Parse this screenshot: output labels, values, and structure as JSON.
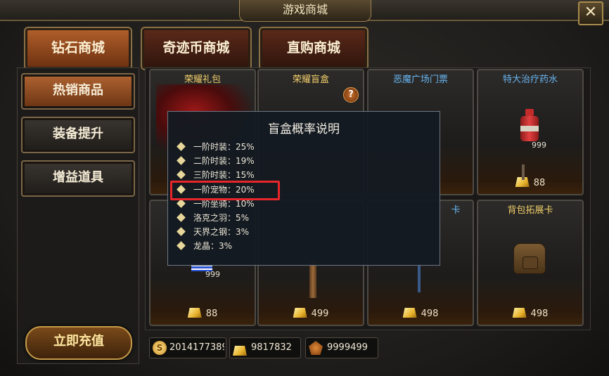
{
  "window": {
    "title": "游戏商城",
    "close_icon": "close-icon"
  },
  "tabs": [
    {
      "label": "钻石商城",
      "active": true
    },
    {
      "label": "奇迹币商城",
      "active": false
    },
    {
      "label": "直购商城",
      "active": false
    }
  ],
  "sidebar": {
    "items": [
      {
        "label": "热销商品",
        "active": true
      },
      {
        "label": "装备提升",
        "active": false
      },
      {
        "label": "增益道具",
        "active": false
      }
    ],
    "recharge_label": "立即充值"
  },
  "cards": [
    {
      "title": "荣耀礼包",
      "price": "",
      "qty": ""
    },
    {
      "title": "荣耀盲盒",
      "price": "",
      "qty": ""
    },
    {
      "title": "恶魔广场门票",
      "price": "",
      "qty": ""
    },
    {
      "title": "特大治疗药水",
      "price": "88",
      "qty": "999"
    },
    {
      "title": "",
      "price": "88",
      "qty": "999"
    },
    {
      "title": "",
      "price": "499",
      "qty": ""
    },
    {
      "title": "卡",
      "price": "498",
      "qty": ""
    },
    {
      "title": "背包拓展卡",
      "price": "498",
      "qty": ""
    }
  ],
  "currency": {
    "coins": "2014177389",
    "gold": "9817832",
    "gems": "9999499",
    "coin_symbol": "S"
  },
  "popup": {
    "title": "盲盒概率说明",
    "items": [
      "一阶时装：25%",
      "二阶时装：19%",
      "三阶时装：15%",
      "一阶宠物：20%",
      "一阶坐骑：10%",
      "洛克之羽：5%",
      "天界之钢：3%",
      "龙晶：3%"
    ],
    "highlighted_index": 3
  },
  "help_symbol": "?",
  "close_symbol": "✕",
  "colors": {
    "accent_gold": "#f0cd6a",
    "accent_blue": "#69b5f0",
    "highlight_red": "#e8262a"
  }
}
